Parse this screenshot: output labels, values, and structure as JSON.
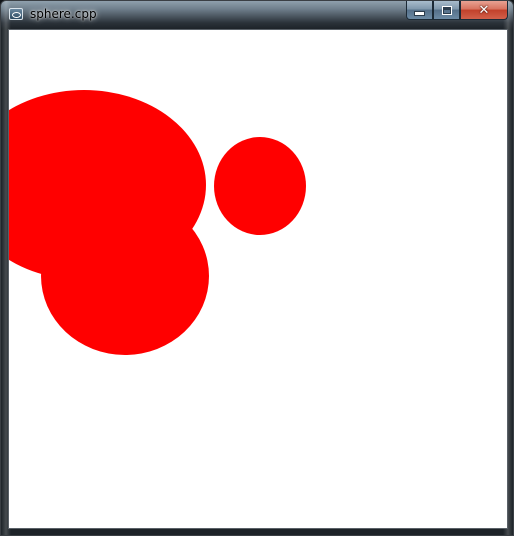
{
  "window": {
    "title": "sphere.cpp",
    "icon": "app-window-icon"
  },
  "controls": {
    "minimize_icon": "minimize-icon",
    "maximize_icon": "maximize-icon",
    "close_glyph": "✕"
  },
  "canvas": {
    "background": "#ffffff",
    "sphere_color": "#ff0000",
    "sphere_count": 3
  }
}
